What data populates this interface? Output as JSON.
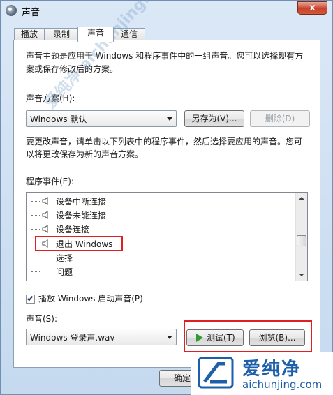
{
  "window": {
    "title": "声音",
    "close_label": "x"
  },
  "tabs": [
    {
      "label": "播放"
    },
    {
      "label": "录制"
    },
    {
      "label": "声音"
    },
    {
      "label": "通信"
    }
  ],
  "intro_line1": "声音主题是应用于 Windows 和程序事件中的一组声音。您可以选择现有方",
  "intro_line2": "案或保存修改后的方案。",
  "scheme": {
    "label": "声音方案(H):",
    "value": "Windows 默认",
    "save_as_label": "另存为(V)...",
    "delete_label": "删除(D)"
  },
  "change_line1": "要更改声音，请单击以下列表中的程序事件，然后选择要应用的声音。您可",
  "change_line2": "以将更改保存为新的声音方案。",
  "program_events": {
    "label": "程序事件(E):",
    "items": [
      {
        "label": "设备中断连接"
      },
      {
        "label": "设备未能连接"
      },
      {
        "label": "设备连接"
      },
      {
        "label": "退出 Windows"
      },
      {
        "label": "选择"
      },
      {
        "label": "问题"
      }
    ]
  },
  "startup_sound": {
    "label": "播放 Windows 启动声音(P)",
    "checked": true
  },
  "sound": {
    "label": "声音(S):",
    "value": "Windows 登录声.wav",
    "test_label": "测试(T)",
    "browse_label": "浏览(B)..."
  },
  "ok_label": "确定",
  "watermark": {
    "diag_text": "爱纯净 aichunjing.com",
    "logo_cn": "爱纯净",
    "logo_url": "aichunjing.com"
  },
  "colors": {
    "highlight": "#e02020",
    "play": "#2f9d2f",
    "brand": "#1d5fa8"
  }
}
